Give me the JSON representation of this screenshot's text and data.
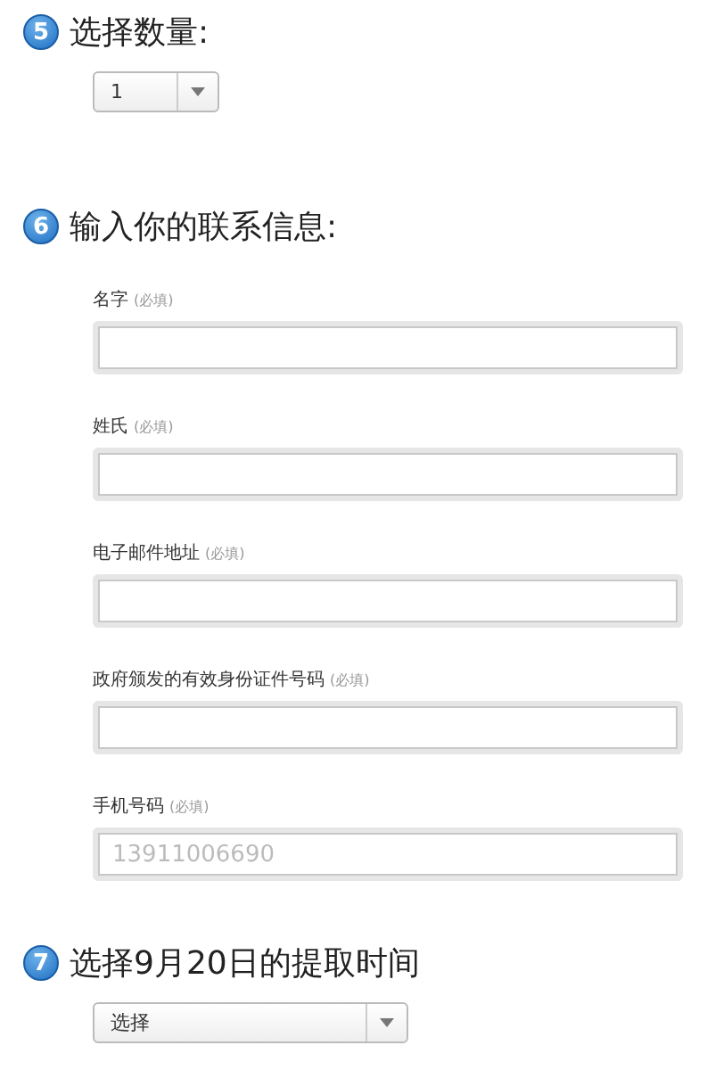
{
  "steps": [
    {
      "number": "5",
      "title": "选择数量:",
      "kind": "select",
      "select": {
        "value": "1"
      }
    },
    {
      "number": "6",
      "title": "输入你的联系信息:",
      "kind": "fields",
      "fields": [
        {
          "label": "名字",
          "note": "(必填)"
        },
        {
          "label": "姓氏",
          "note": "(必填)"
        },
        {
          "label": "电子邮件地址",
          "note": "(必填)"
        },
        {
          "label": "政府颁发的有效身份证件号码",
          "note": "(必填)"
        },
        {
          "label": "手机号码",
          "note": "(必填)",
          "placeholder": "13911006690"
        }
      ]
    },
    {
      "number": "7",
      "title": "选择9月20日的提取时间",
      "kind": "select",
      "select": {
        "value": "选择"
      }
    }
  ]
}
